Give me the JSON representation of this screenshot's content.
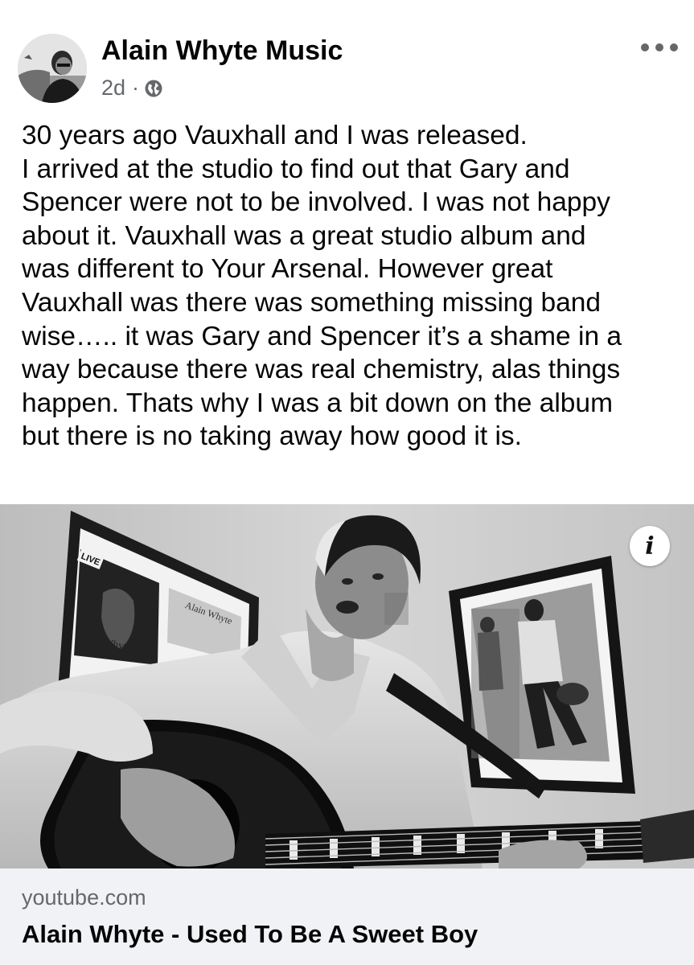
{
  "post": {
    "author": "Alain Whyte Music",
    "timestamp": "2d",
    "separator": "·",
    "privacy_icon": "globe-icon",
    "more_icon": "more-options-icon",
    "text_lines": [
      "30 years ago Vauxhall and I was released.",
      "I arrived at the studio to find out that Gary and",
      "Spencer were not to be involved. I was not happy",
      "about it. Vauxhall was a great studio album and",
      "was different to Your Arsenal. However great",
      "Vauxhall was there was something missing band",
      "wise….. it was Gary and Spencer it’s a shame in a",
      "way because there was real chemistry, alas things",
      "happen. Thats why I was a bit down on the album",
      "but there is no taking away how good it is."
    ]
  },
  "media": {
    "description_icon": "video-thumbnail",
    "info_label": "i",
    "poster_left": {
      "badge": "LIVE",
      "caption1": "Alain Whyte",
      "caption2": "Alain Whyte"
    }
  },
  "link": {
    "domain": "youtube.com",
    "title": "Alain Whyte - Used To Be A Sweet Boy"
  },
  "colors": {
    "text_primary": "#050505",
    "text_secondary": "#65676b",
    "link_background": "#f0f2f5"
  }
}
